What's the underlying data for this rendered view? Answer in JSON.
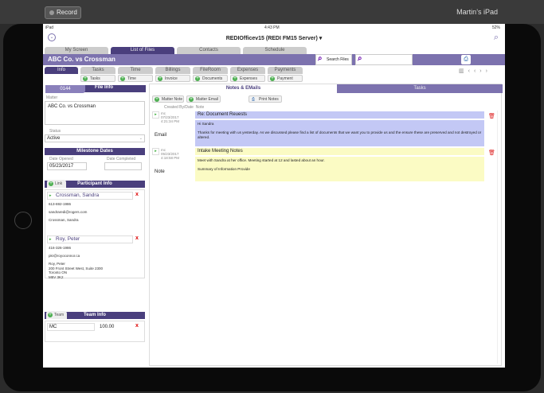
{
  "recorder": {
    "record_label": "Record",
    "device_name": "Martin’s iPad"
  },
  "status_bar": {
    "left": "iPad",
    "time": "4:43 PM",
    "battery": "52%"
  },
  "app": {
    "title": "REDIOfficev15 (REDI FM15 Server)"
  },
  "main_tabs": [
    {
      "label": "My Screen"
    },
    {
      "label": "List of Files"
    },
    {
      "label": "Contacts"
    },
    {
      "label": "Schedule"
    }
  ],
  "file": {
    "title": "ABC Co. vs Crossman",
    "search_files_label": "Search Files",
    "search_value": ""
  },
  "sub_tabs": [
    {
      "label": "Info"
    },
    {
      "label": "Tasks"
    },
    {
      "label": "Time"
    },
    {
      "label": "Billings"
    },
    {
      "label": "FileRoom"
    },
    {
      "label": "Expenses"
    },
    {
      "label": "Payments"
    }
  ],
  "add_buttons": [
    {
      "label": "Tasks"
    },
    {
      "label": "Time"
    },
    {
      "label": "Invoice"
    },
    {
      "label": "Documents"
    },
    {
      "label": "Expenses"
    },
    {
      "label": "Payment"
    }
  ],
  "left": {
    "file_number": "0144",
    "file_info_label": "File Info",
    "matter_label": "Matter",
    "matter_value": "ABC Co. vs Crossman",
    "status_label": "Status",
    "status_value": "Active",
    "milestone_header": "Milestone Dates",
    "date_opened_label": "Date Opened",
    "date_opened": "05/23/2017",
    "date_completed_label": "Date Completed",
    "date_completed": "",
    "link_label": "Link",
    "participant_header": "Participant Info",
    "participants": [
      {
        "name": "Crossman, Sandra",
        "phone": "613-692-1986",
        "email": "sandraredi@rogers.com",
        "address": [
          "Crossman, Sandra"
        ]
      },
      {
        "name": "Roy, Peter",
        "phone": "416-326-1986",
        "email": "pkr@royoconnor.ca",
        "address": [
          "Roy, Peter",
          "200 Front Street West, Suite 2300",
          "Toronto ON",
          "M5V 3K2"
        ]
      }
    ],
    "team_label": "Team",
    "team_header": "Team Info",
    "team": [
      {
        "code": "MC",
        "value": "100.00"
      }
    ]
  },
  "right": {
    "tab_notes": "Notes & EMails",
    "tab_tasks": "Tasks",
    "matter_note_label": "Matter Note",
    "matter_email_label": "Matter Email",
    "print_notes_label": "Print Notes",
    "col_created": "Created By/Date",
    "col_note": "Note",
    "notes": [
      {
        "by": "mc",
        "date": "07/23/2017",
        "time": "4:21:34 PM",
        "type": "Email",
        "subject": "Re: Document Reuests",
        "body": [
          "Hi Sandra",
          "Thanks for meeting with us yesterday. As we discussed please find a list of documents that we want you to provide us and the ensure these are preserved and not destroyed or altered."
        ],
        "color": "#c3c8f5"
      },
      {
        "by": "mc",
        "date": "05/23/2017",
        "time": "4:18:58 PM",
        "type": "Note",
        "subject": "Intake Meeting Notes",
        "body": [
          "Meet with Sandra at her office. Meeting started at 12 and lasted about an hour.",
          "Summary of Information Provide"
        ],
        "color": "#fbfbc4"
      }
    ]
  },
  "colors": {
    "accent": "#4a3f7d",
    "band": "#7c72ae"
  }
}
